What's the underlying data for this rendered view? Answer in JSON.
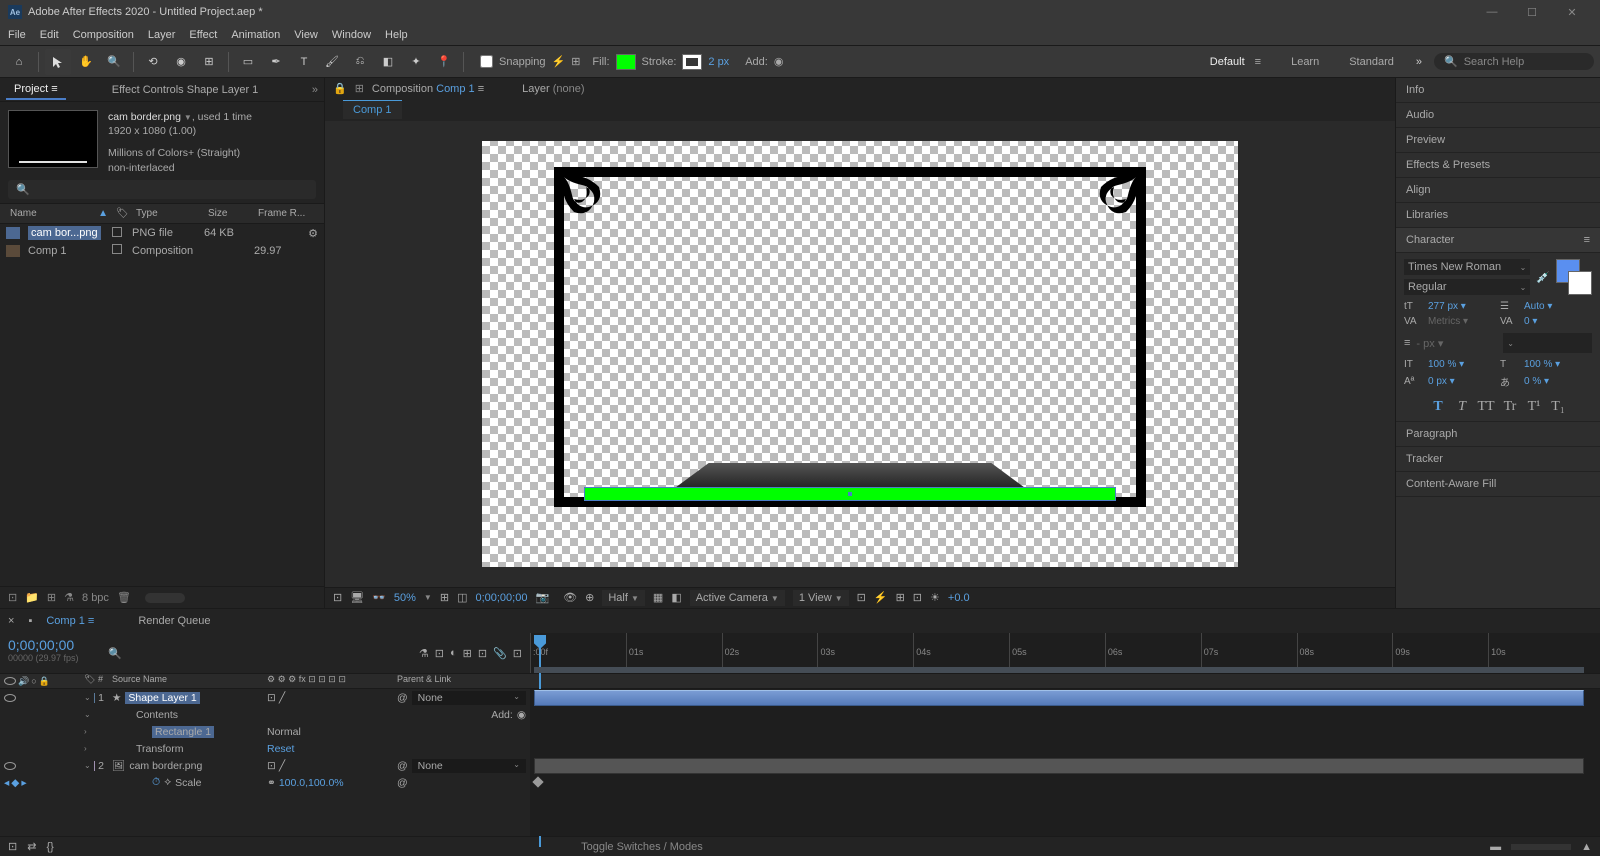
{
  "titlebar": {
    "title": "Adobe After Effects 2020 - Untitled Project.aep *"
  },
  "menu": [
    "File",
    "Edit",
    "Composition",
    "Layer",
    "Effect",
    "Animation",
    "View",
    "Window",
    "Help"
  ],
  "toolbar": {
    "snapping": "Snapping",
    "fill_label": "Fill:",
    "stroke_label": "Stroke:",
    "stroke_px": "2 px",
    "add": "Add:",
    "search_placeholder": "Search Help"
  },
  "workspaces": {
    "default": "Default",
    "learn": "Learn",
    "standard": "Standard"
  },
  "project": {
    "tab_project": "Project",
    "tab_effect": "Effect Controls Shape Layer 1",
    "asset_name": "cam border.png",
    "asset_used": ", used 1 time",
    "asset_dim": "1920 x 1080 (1.00)",
    "asset_colors": "Millions of Colors+ (Straight)",
    "asset_interlace": "non-interlaced",
    "cols": {
      "name": "Name",
      "type": "Type",
      "size": "Size",
      "fr": "Frame R..."
    },
    "rows": [
      {
        "name": "cam bor...png",
        "type": "PNG file",
        "size": "64 KB",
        "fr": ""
      },
      {
        "name": "Comp 1",
        "type": "Composition",
        "size": "",
        "fr": "29.97"
      }
    ],
    "footer_bpc": "8 bpc"
  },
  "comp": {
    "tab_composition": "Composition",
    "tab_active": "Comp 1",
    "tab_layer": "Layer",
    "tab_none": "(none)",
    "footer": {
      "zoom": "50%",
      "time": "0;00;00;00",
      "res": "Half",
      "camera": "Active Camera",
      "view": "1 View",
      "exposure": "+0.0"
    }
  },
  "right_panels": [
    "Info",
    "Audio",
    "Preview",
    "Effects & Presets",
    "Align",
    "Libraries"
  ],
  "character": {
    "title": "Character",
    "font": "Times New Roman",
    "style": "Regular",
    "size": "277 px",
    "leading": "Auto",
    "kerning": "Metrics",
    "tracking": "0",
    "stroke_w": "- px",
    "vscale": "100 %",
    "hscale": "100 %",
    "baseline": "0 px",
    "tsume": "0 %",
    "buttons": [
      "T",
      "T",
      "TT",
      "Tr",
      "T¹",
      "T₁"
    ]
  },
  "right_panels2": [
    "Paragraph",
    "Tracker",
    "Content-Aware Fill"
  ],
  "timeline": {
    "tab_comp": "Comp 1",
    "tab_render": "Render Queue",
    "timecode": "0;00;00;00",
    "frames": "00000 (29.97 fps)",
    "marks": [
      ":00f",
      "01s",
      "02s",
      "03s",
      "04s",
      "05s",
      "06s",
      "07s",
      "08s",
      "09s",
      "10s"
    ],
    "cols": {
      "num": "#",
      "name": "Source Name",
      "parent": "Parent & Link"
    },
    "layer1": {
      "num": "1",
      "name": "Shape Layer 1",
      "parent": "None"
    },
    "contents": "Contents",
    "add": "Add:",
    "rect": "Rectangle 1",
    "normal": "Normal",
    "transform": "Transform",
    "reset": "Reset",
    "layer2": {
      "num": "2",
      "name": "cam border.png",
      "parent": "None"
    },
    "scale": "Scale",
    "scale_val": "100.0,100.0%",
    "toggle": "Toggle Switches / Modes"
  }
}
